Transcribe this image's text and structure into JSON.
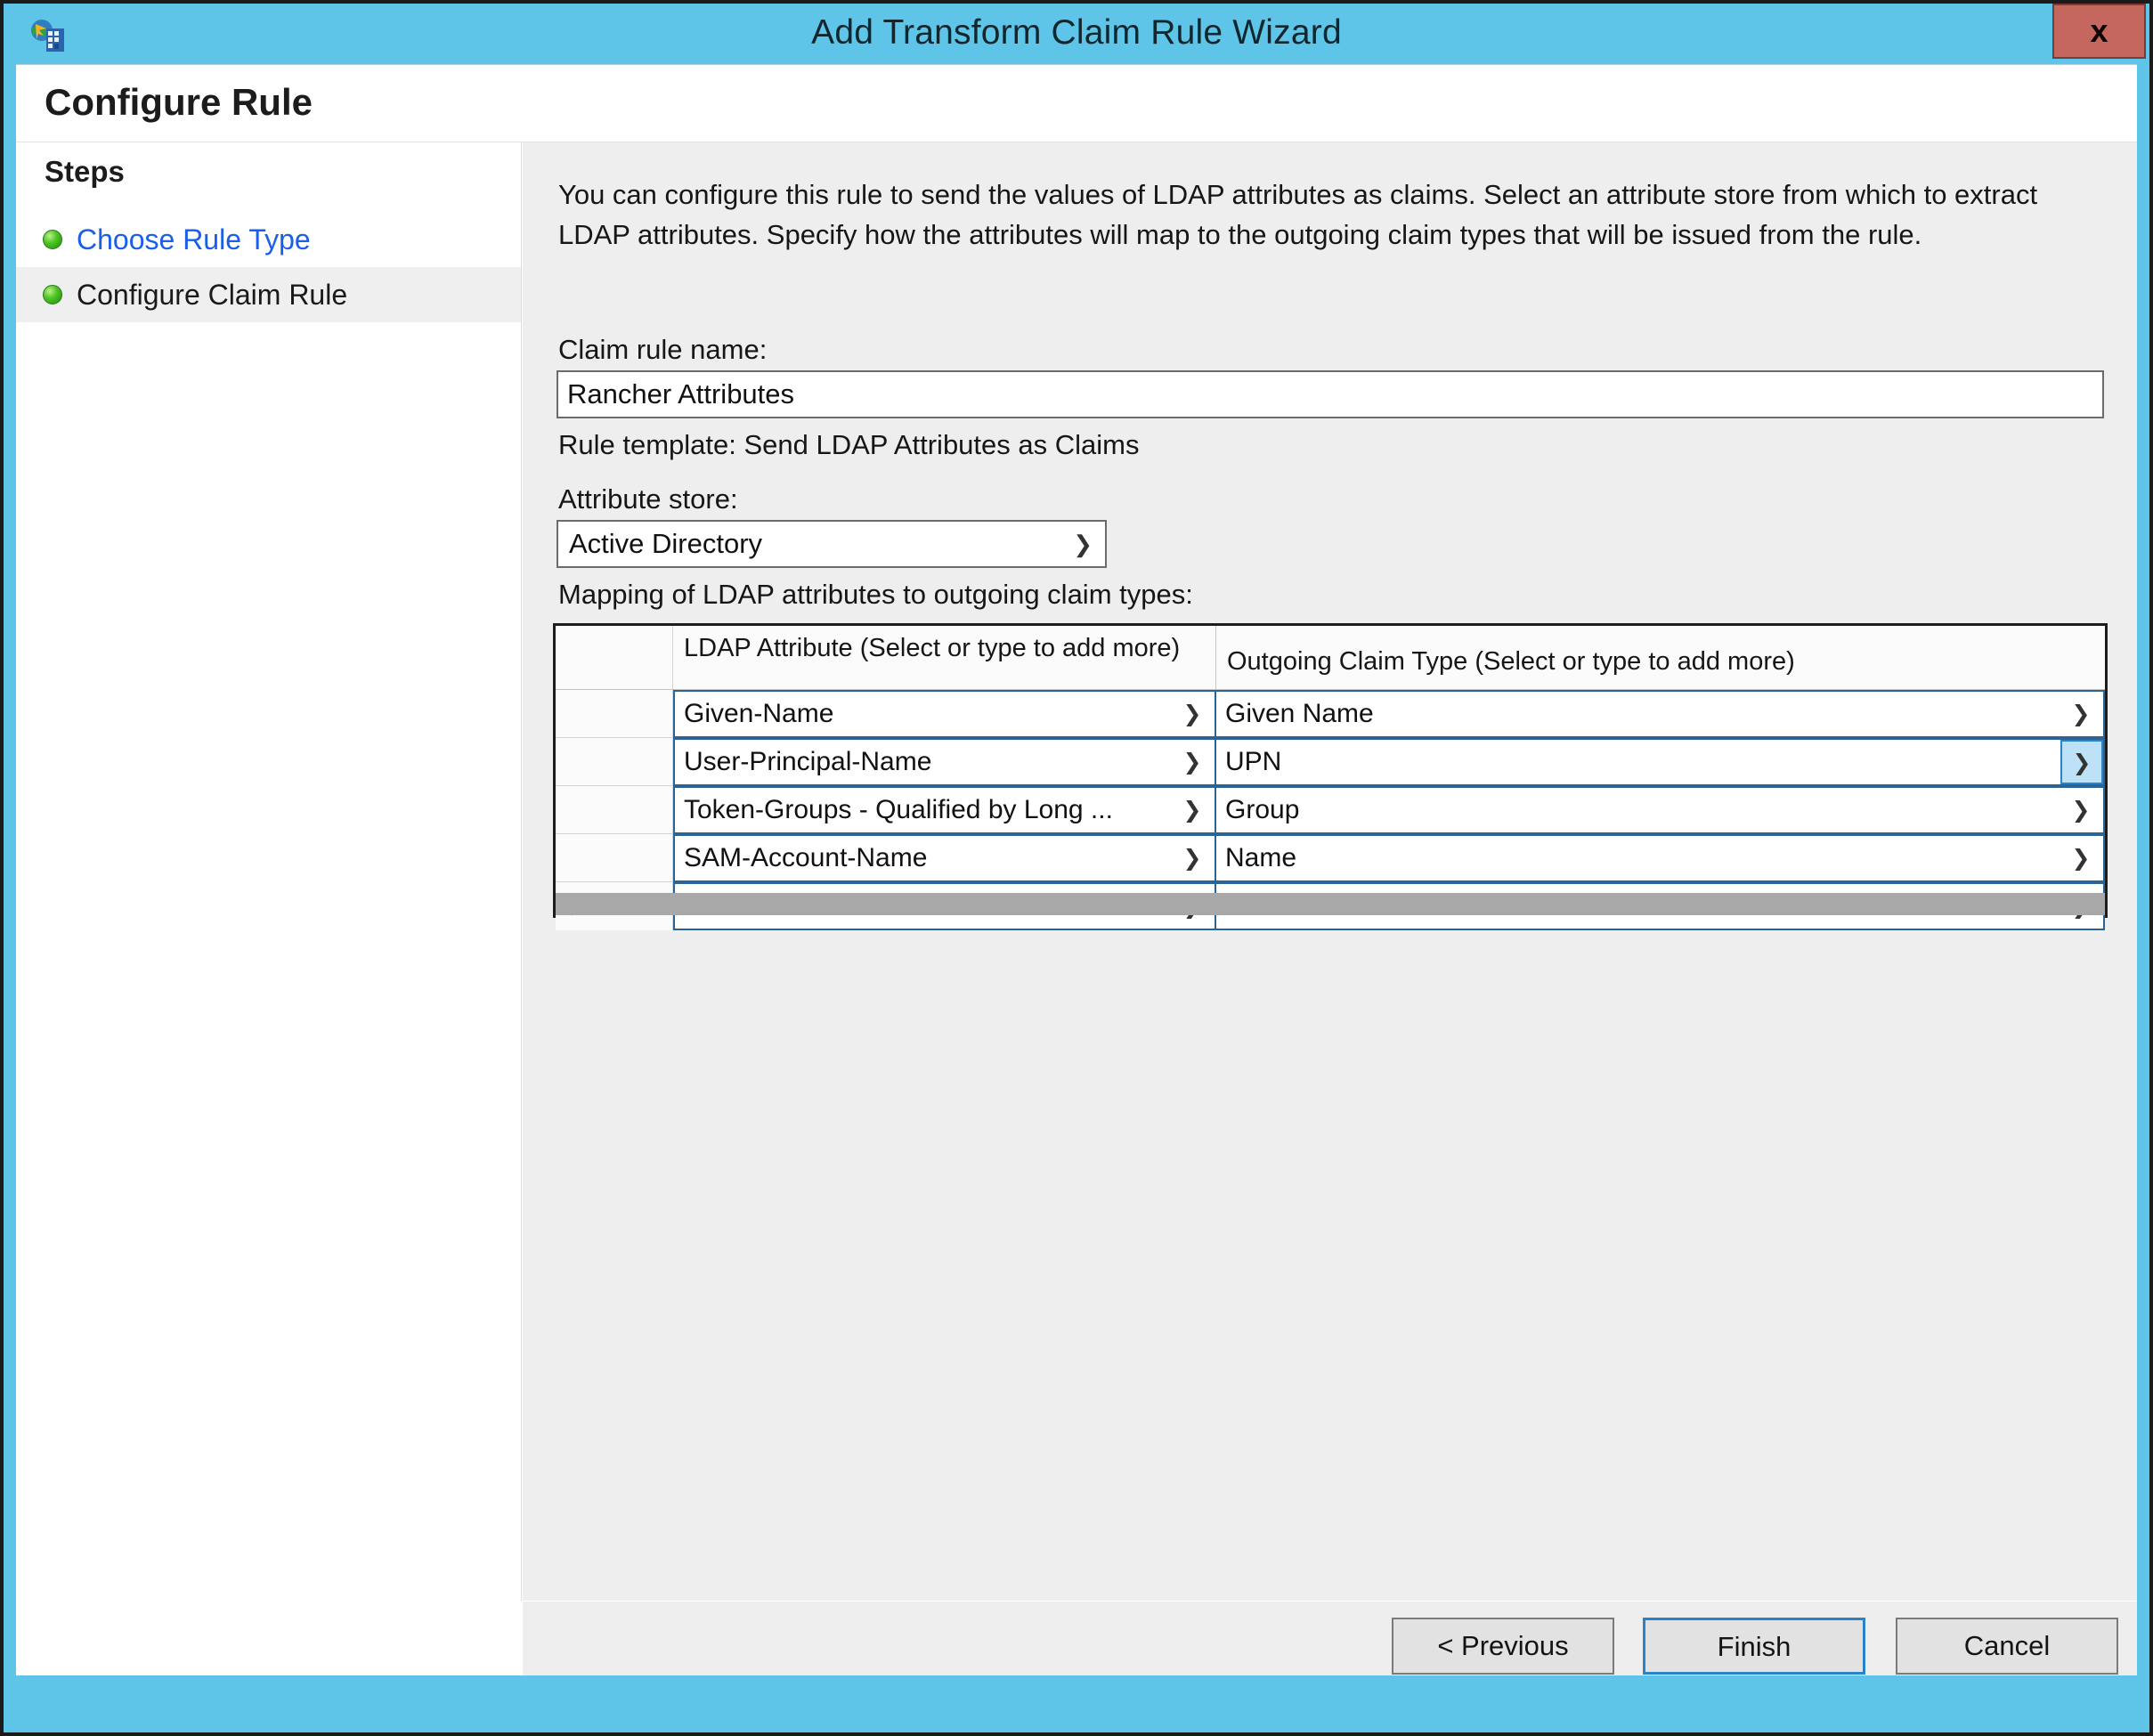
{
  "window": {
    "title": "Add Transform Claim Rule Wizard",
    "close_label": "x",
    "icon": "claim-rule-wizard-icon"
  },
  "page": {
    "title": "Configure Rule"
  },
  "sidebar": {
    "heading": "Steps",
    "items": [
      {
        "label": "Choose Rule Type",
        "state": "link"
      },
      {
        "label": "Configure Claim Rule",
        "state": "active"
      }
    ]
  },
  "content": {
    "intro": "You can configure this rule to send the values of LDAP attributes as claims. Select an attribute store from which to extract LDAP attributes. Specify how the attributes will map to the outgoing claim types that will be issued from the rule.",
    "claim_rule_name_label": "Claim rule name:",
    "claim_rule_name_value": "Rancher Attributes",
    "claim_rule_name_placeholder": "",
    "rule_template_text": "Rule template: Send LDAP Attributes as Claims",
    "attribute_store_label": "Attribute store:",
    "attribute_store_value": "Active Directory",
    "attribute_store_options": [
      "Active Directory"
    ],
    "mapping_label": "Mapping of LDAP attributes to outgoing claim types:"
  },
  "grid": {
    "columns": [
      "LDAP Attribute (Select or type to add more)",
      "Outgoing Claim Type (Select or type to add more)"
    ],
    "new_row_indicator": "▶*",
    "rows": [
      {
        "ldap_attribute": "Given-Name",
        "outgoing_claim_type": "Given Name",
        "focused": false
      },
      {
        "ldap_attribute": "User-Principal-Name",
        "outgoing_claim_type": "UPN",
        "focused": true
      },
      {
        "ldap_attribute": "Token-Groups - Qualified by Long ...",
        "outgoing_claim_type": "Group",
        "focused": false
      },
      {
        "ldap_attribute": "SAM-Account-Name",
        "outgoing_claim_type": "Name",
        "focused": false
      },
      {
        "ldap_attribute": "",
        "outgoing_claim_type": "",
        "focused": false
      }
    ]
  },
  "footer": {
    "previous_label": "< Previous",
    "finish_label": "Finish",
    "cancel_label": "Cancel"
  },
  "colors": {
    "window_frame": "#5ec5e8",
    "close_button": "#c6675f",
    "link": "#1b5ee8",
    "focus_border": "#2a82c8",
    "focus_fill": "#bde2f7",
    "step_bullet": "#4ec425"
  }
}
